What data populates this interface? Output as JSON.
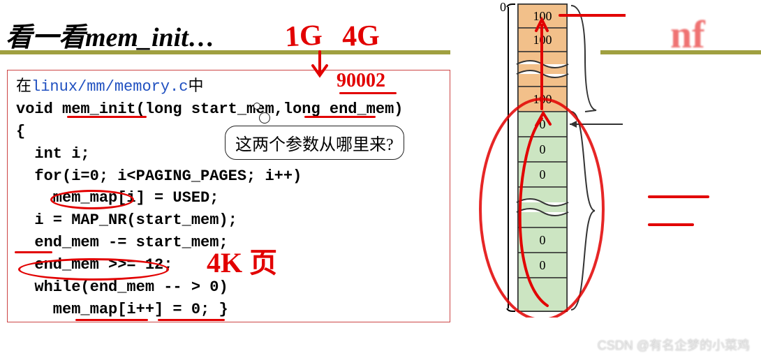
{
  "title": "看一看mem_init…",
  "code": {
    "header_cn": "在",
    "header_path": "linux/mm/memory.c",
    "header_cn2": "中",
    "l1": "void mem_init(long start_mem,long end_mem)",
    "l2": "{",
    "l3": "  int i;",
    "l4": "  for(i=0; i<PAGING_PAGES; i++)",
    "l5": "    mem_map[i] = USED;",
    "l6": "  i = MAP_NR(start_mem);",
    "l7": "  end_mem -= start_mem;",
    "l8": "  end_mem >>= 12;",
    "l9": "  while(end_mem -- > 0)",
    "l10": "    mem_map[i++] = 0; }"
  },
  "bubble": "这两个参数从哪里来?",
  "annotations": {
    "hw1": "1G",
    "hw2": "4G",
    "hw3": "90002",
    "hw4": "4K 页"
  },
  "memmap": {
    "zero_label": "0",
    "cells_top": [
      "100",
      "100",
      "100"
    ],
    "cells_bottom": [
      "0",
      "0",
      "0",
      "0",
      "0"
    ]
  },
  "watermark": "CSDN @有名企梦的小菜鸡"
}
